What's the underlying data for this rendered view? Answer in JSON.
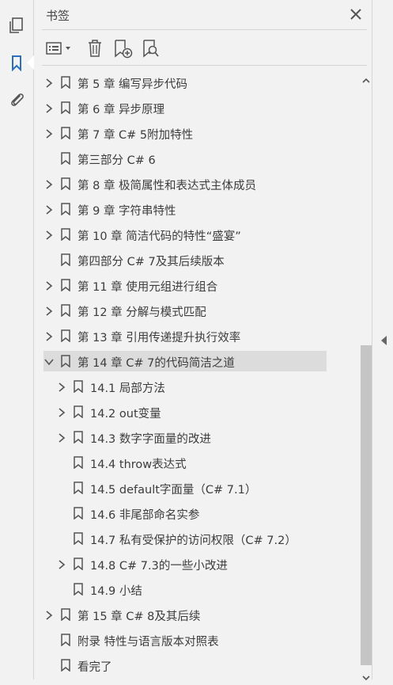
{
  "panel": {
    "title": "书签"
  },
  "leftbar": {
    "icons": [
      "pages-icon",
      "bookmark-icon",
      "attachment-icon"
    ]
  },
  "toolbar": {
    "buttons": [
      "options-menu",
      "delete-bookmark",
      "new-bookmark",
      "bookmark-search"
    ]
  },
  "bookmarks": [
    {
      "label": "第 5 章 编写异步代码",
      "level": 0,
      "expander": "collapsed"
    },
    {
      "label": "第 6 章 异步原理",
      "level": 0,
      "expander": "collapsed"
    },
    {
      "label": "第 7 章 C# 5附加特性",
      "level": 0,
      "expander": "collapsed"
    },
    {
      "label": "第三部分 C# 6",
      "level": 0,
      "expander": "none"
    },
    {
      "label": "第 8 章 极简属性和表达式主体成员",
      "level": 0,
      "expander": "collapsed"
    },
    {
      "label": "第 9 章 字符串特性",
      "level": 0,
      "expander": "collapsed"
    },
    {
      "label": "第 10 章 简洁代码的特性“盛宴”",
      "level": 0,
      "expander": "collapsed"
    },
    {
      "label": "第四部分 C# 7及其后续版本",
      "level": 0,
      "expander": "none"
    },
    {
      "label": "第 11 章 使用元组进行组合",
      "level": 0,
      "expander": "collapsed"
    },
    {
      "label": "第 12 章 分解与模式匹配",
      "level": 0,
      "expander": "collapsed"
    },
    {
      "label": "第 13 章 引用传递提升执行效率",
      "level": 0,
      "expander": "collapsed"
    },
    {
      "label": "第 14 章 C# 7的代码简洁之道",
      "level": 0,
      "expander": "expanded",
      "selected": true
    },
    {
      "label": "14.1 局部方法",
      "level": 1,
      "expander": "collapsed"
    },
    {
      "label": "14.2 out变量",
      "level": 1,
      "expander": "collapsed"
    },
    {
      "label": "14.3 数字字面量的改进",
      "level": 1,
      "expander": "collapsed"
    },
    {
      "label": "14.4 throw表达式",
      "level": 1,
      "expander": "none"
    },
    {
      "label": "14.5 default字面量（C# 7.1）",
      "level": 1,
      "expander": "none"
    },
    {
      "label": "14.6 非尾部命名实参",
      "level": 1,
      "expander": "none"
    },
    {
      "label": "14.7 私有受保护的访问权限（C# 7.2）",
      "level": 1,
      "expander": "none"
    },
    {
      "label": "14.8 C# 7.3的一些小改进",
      "level": 1,
      "expander": "collapsed"
    },
    {
      "label": "14.9 小结",
      "level": 1,
      "expander": "none"
    },
    {
      "label": "第 15 章 C# 8及其后续",
      "level": 0,
      "expander": "collapsed"
    },
    {
      "label": "附录 特性与语言版本对照表",
      "level": 0,
      "expander": "none"
    },
    {
      "label": "看完了",
      "level": 0,
      "expander": "none"
    }
  ]
}
